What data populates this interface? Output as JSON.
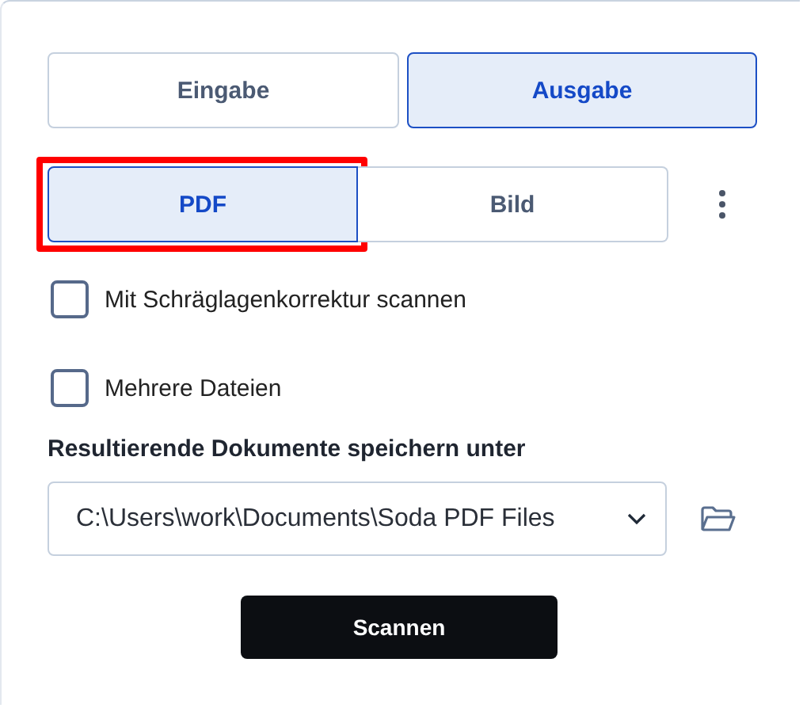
{
  "mode_tabs": [
    {
      "label": "Eingabe",
      "selected": false
    },
    {
      "label": "Ausgabe",
      "selected": true
    }
  ],
  "format_options": [
    {
      "label": "PDF",
      "selected": true,
      "highlighted": true
    },
    {
      "label": "Bild",
      "selected": false,
      "highlighted": false
    }
  ],
  "options": [
    {
      "label": "Mit Schräglagenkorrektur scannen",
      "checked": false
    },
    {
      "label": "Mehrere Dateien",
      "checked": false
    }
  ],
  "save_location": {
    "label": "Resultierende Dokumente speichern unter",
    "value": "C:\\Users\\work\\Documents\\Soda PDF Files"
  },
  "scan_button": {
    "label": "Scannen"
  }
}
